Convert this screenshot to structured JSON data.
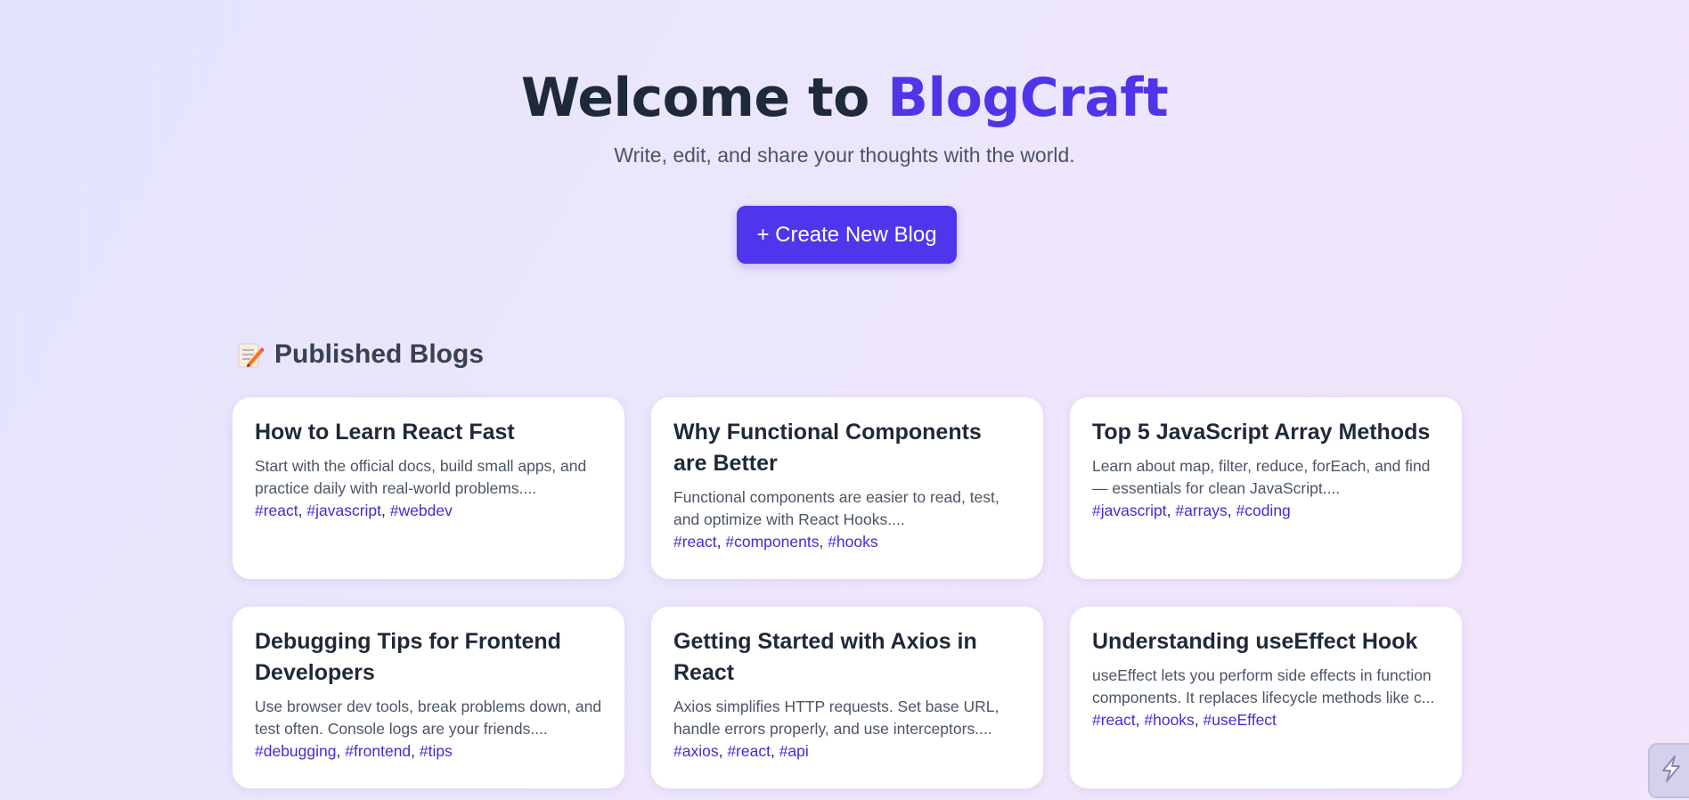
{
  "hero": {
    "title_prefix": "Welcome to ",
    "title_brand": "BlogCraft",
    "subtitle": "Write, edit, and share your thoughts with the world.",
    "create_button_label": "+ Create New Blog"
  },
  "section": {
    "icon": "memo-icon",
    "title": "Published Blogs"
  },
  "colors": {
    "accent": "#4f35ec",
    "tag": "#3d2fd0",
    "heading": "#1e293b"
  },
  "blogs": [
    {
      "title": "How to Learn React Fast",
      "excerpt": "Start with the official docs, build small apps, and practice daily with real-world problems....",
      "tags": [
        "#react",
        "#javascript",
        "#webdev"
      ]
    },
    {
      "title": "Why Functional Components are Better",
      "excerpt": "Functional components are easier to read, test, and optimize with React Hooks....",
      "tags": [
        "#react",
        "#components",
        "#hooks"
      ]
    },
    {
      "title": "Top 5 JavaScript Array Methods",
      "excerpt": "Learn about map, filter, reduce, forEach, and find — essentials for clean JavaScript....",
      "tags": [
        "#javascript",
        "#arrays",
        "#coding"
      ]
    },
    {
      "title": "Debugging Tips for Frontend Developers",
      "excerpt": "Use browser dev tools, break problems down, and test often. Console logs are your friends....",
      "tags": [
        "#debugging",
        "#frontend",
        "#tips"
      ]
    },
    {
      "title": "Getting Started with Axios in React",
      "excerpt": "Axios simplifies HTTP requests. Set base URL, handle errors properly, and use interceptors....",
      "tags": [
        "#axios",
        "#react",
        "#api"
      ]
    },
    {
      "title": "Understanding useEffect Hook",
      "excerpt": "useEffect lets you perform side effects in function components. It replaces lifecycle methods like c...",
      "tags": [
        "#react",
        "#hooks",
        "#useEffect"
      ]
    }
  ],
  "widget": {
    "icon": "lightning-bolt-icon"
  }
}
